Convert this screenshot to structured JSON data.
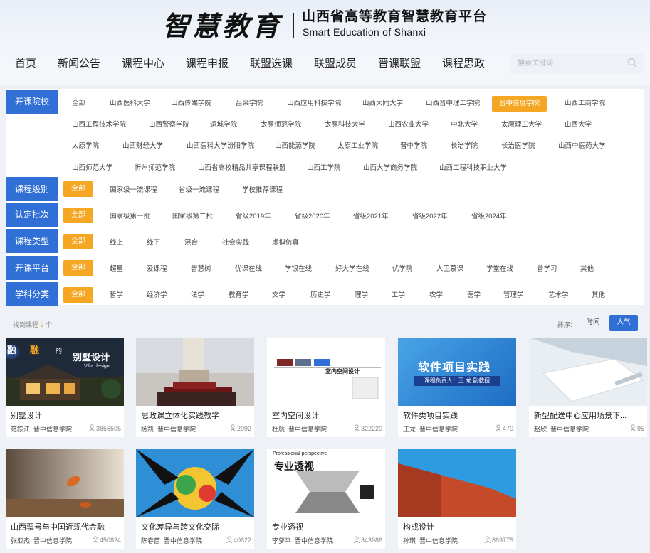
{
  "header": {
    "logo_calligraphy": "智慧教育",
    "title": "山西省高等教育智慧教育平台",
    "subtitle": "Smart Education of Shanxi"
  },
  "nav": {
    "items": [
      "首页",
      "新闻公告",
      "课程中心",
      "课程申报",
      "联盟选课",
      "联盟成员",
      "晋课联盟",
      "课程思政"
    ]
  },
  "search": {
    "placeholder": "搜索关键词",
    "icon": "search-icon"
  },
  "filters": {
    "school": {
      "label": "开课院校",
      "options": [
        "全部",
        "山西医科大学",
        "山西传媒学院",
        "吕梁学院",
        "山西应用科技学院",
        "山西大同大学",
        "山西晋中理工学院",
        "晋中信息学院",
        "山西工商学院",
        "山西工程技术学院",
        "山西警察学院",
        "运城学院",
        "太原师范学院",
        "太原科技大学",
        "山西农业大学",
        "中北大学",
        "太原理工大学",
        "山西大学",
        "太原学院",
        "山西财经大学",
        "山西医科大学汾阳学院",
        "山西能源学院",
        "太原工业学院",
        "晋中学院",
        "长治学院",
        "长治医学院",
        "山西中医药大学",
        "山西师范大学",
        "忻州师范学院",
        "山西省高校精品共享课程联盟",
        "山西工学院",
        "山西大学商务学院",
        "山西工程科技职业大学"
      ],
      "selected": "晋中信息学院"
    },
    "level": {
      "label": "课程级别",
      "all": "全部",
      "options": [
        "国家级一流课程",
        "省级一流课程",
        "学校推荐课程"
      ]
    },
    "batch": {
      "label": "认定批次",
      "all": "全部",
      "options": [
        "国家级第一批",
        "国家级第二批",
        "省级2019年",
        "省级2020年",
        "省级2021年",
        "省级2022年",
        "省级2024年"
      ]
    },
    "type": {
      "label": "课程类型",
      "all": "全部",
      "options": [
        "线上",
        "线下",
        "混合",
        "社会实践",
        "虚拟仿真"
      ]
    },
    "platform": {
      "label": "开课平台",
      "all": "全部",
      "options": [
        "超星",
        "爱课程",
        "智慧树",
        "优课在线",
        "学银在线",
        "好大学在线",
        "优学院",
        "人卫慕课",
        "学堂在线",
        "善学习",
        "其他"
      ]
    },
    "subject": {
      "label": "学科分类",
      "all": "全部",
      "options": [
        "哲学",
        "经济学",
        "法学",
        "教育学",
        "文学",
        "历史学",
        "理学",
        "工学",
        "农学",
        "医学",
        "管理学",
        "艺术学",
        "其他"
      ]
    }
  },
  "results": {
    "prefix": "找到课程",
    "count": "9",
    "suffix": "个"
  },
  "sort": {
    "label": "排序:",
    "time": "时间",
    "hot": "人气"
  },
  "courses": [
    {
      "title": "别墅设计",
      "teacher": "范銨江",
      "school": "晋中信息学院",
      "count": "3856505",
      "thumb_text": "别墅设计",
      "thumb_sub": "Villa design"
    },
    {
      "title": "思政课立体化实践教学",
      "teacher": "杨凯",
      "school": "晋中信息学院",
      "count": "2092"
    },
    {
      "title": "室内空间设计",
      "teacher": "杜航",
      "school": "晋中信息学院",
      "count": "322220",
      "thumb_text": "室内空间设计"
    },
    {
      "title": "软件类项目实践",
      "teacher": "王龙",
      "school": "晋中信息学院",
      "count": "470",
      "thumb_text": "软件项目实践",
      "thumb_sub": "课程负责人：王 龙 副教授"
    },
    {
      "title": "新型配送中心应用场景下...",
      "teacher": "赵欣",
      "school": "晋中信息学院",
      "count": "95"
    },
    {
      "title": "山西票号与中国近现代金融",
      "teacher": "张亚杰",
      "school": "晋中信息学院",
      "count": "450824"
    },
    {
      "title": "文化差异与跨文化交际",
      "teacher": "陈春苗",
      "school": "晋中信息学院",
      "count": "40622"
    },
    {
      "title": "专业透视",
      "teacher": "李萝平",
      "school": "晋中信息学院",
      "count": "343986",
      "thumb_text": "专业透视",
      "thumb_sub": "Professional perspective"
    },
    {
      "title": "构成设计",
      "teacher": "孙琪",
      "school": "晋中信息学院",
      "count": "869775"
    }
  ],
  "colors": {
    "primary": "#2f6fd6",
    "accent": "#f5a623"
  }
}
